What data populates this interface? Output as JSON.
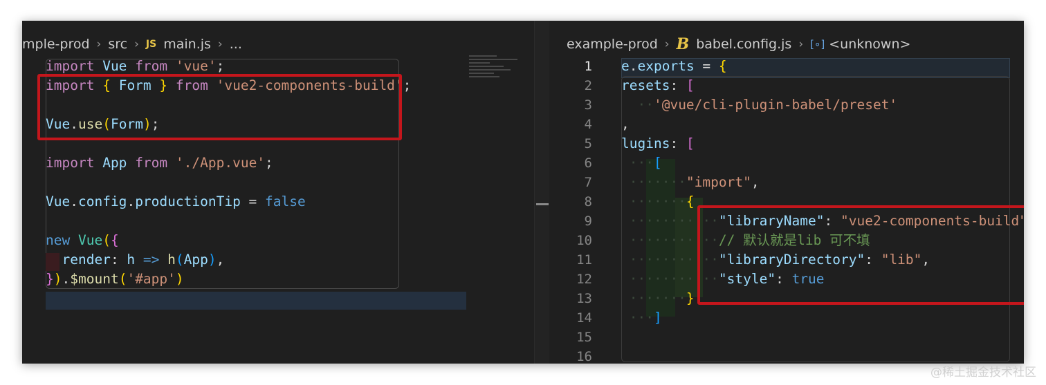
{
  "left_editor": {
    "breadcrumb": [
      "mple-prod",
      "src",
      "main.js",
      "..."
    ],
    "file_icon": "JS",
    "lines": {
      "l1": {
        "a": "import",
        "b": "Vue",
        "c": "from",
        "d": "'vue'",
        "e": ";"
      },
      "l2": {
        "a": "import",
        "b": "{",
        "c": "Form",
        "d": "}",
        "e": "from",
        "f": "'vue2-components-build'",
        "g": ";"
      },
      "l4": {
        "a": "Vue",
        "b": ".",
        "c": "use",
        "d": "(",
        "e": "Form",
        "f": ")",
        "g": ";"
      },
      "l6": {
        "a": "import",
        "b": "App",
        "c": "from",
        "d": "'./App.vue'",
        "e": ";"
      },
      "l8": {
        "a": "Vue",
        "b": ".",
        "c": "config",
        "d": ".",
        "e": "productionTip",
        "f": " = ",
        "g": "false"
      },
      "l10": {
        "a": "new",
        "b": "Vue",
        "c": "(",
        "d": "{"
      },
      "l11": {
        "a": "render",
        "b": ": ",
        "c": "h",
        "d": "=>",
        "e": "h",
        "f": "(",
        "g": "App",
        "h": ")",
        "i": ","
      },
      "l12": {
        "a": "}",
        "b": ")",
        "c": ".",
        "d": "$mount",
        "e": "(",
        "f": "'#app'",
        "g": ")"
      }
    }
  },
  "right_editor": {
    "breadcrumb": [
      "example-prod",
      "babel.config.js",
      "<unknown>"
    ],
    "file_icon": "B",
    "line_numbers": [
      "1",
      "2",
      "3",
      "4",
      "5",
      "6",
      "7",
      "8",
      "9",
      "10",
      "11",
      "12",
      "13",
      "14",
      "15",
      "16"
    ],
    "lines": {
      "l1": {
        "a": "e",
        "b": ".",
        "c": "exports",
        "d": " = ",
        "e": "{"
      },
      "l2": {
        "a": "resets",
        "b": ": ",
        "c": "["
      },
      "l3": {
        "a": "'@vue/cli-plugin-babel/preset'"
      },
      "l4": {
        "a": ","
      },
      "l5": {
        "a": "lugins",
        "b": ": ",
        "c": "["
      },
      "l6": {
        "a": "["
      },
      "l7": {
        "a": "\"import\"",
        "b": ","
      },
      "l8": {
        "a": "{"
      },
      "l9": {
        "a": "\"libraryName\"",
        "b": ": ",
        "c": "\"vue2-components-build\""
      },
      "l10": {
        "a": "// 默认就是lib 可不填"
      },
      "l11": {
        "a": "\"libraryDirectory\"",
        "b": ": ",
        "c": "\"lib\"",
        "d": ","
      },
      "l12": {
        "a": "\"style\"",
        "b": ": ",
        "c": "true"
      },
      "l13": {
        "a": "}"
      },
      "l14": {
        "a": "]"
      }
    }
  },
  "watermark": "@稀土掘金技术社区",
  "colors": {
    "highlight_box": "#c4161c",
    "editor_bg": "#1f1f1f",
    "keyword": "#c586c0",
    "string": "#ce9178",
    "variable": "#9cdcfe",
    "comment": "#6a9955"
  }
}
